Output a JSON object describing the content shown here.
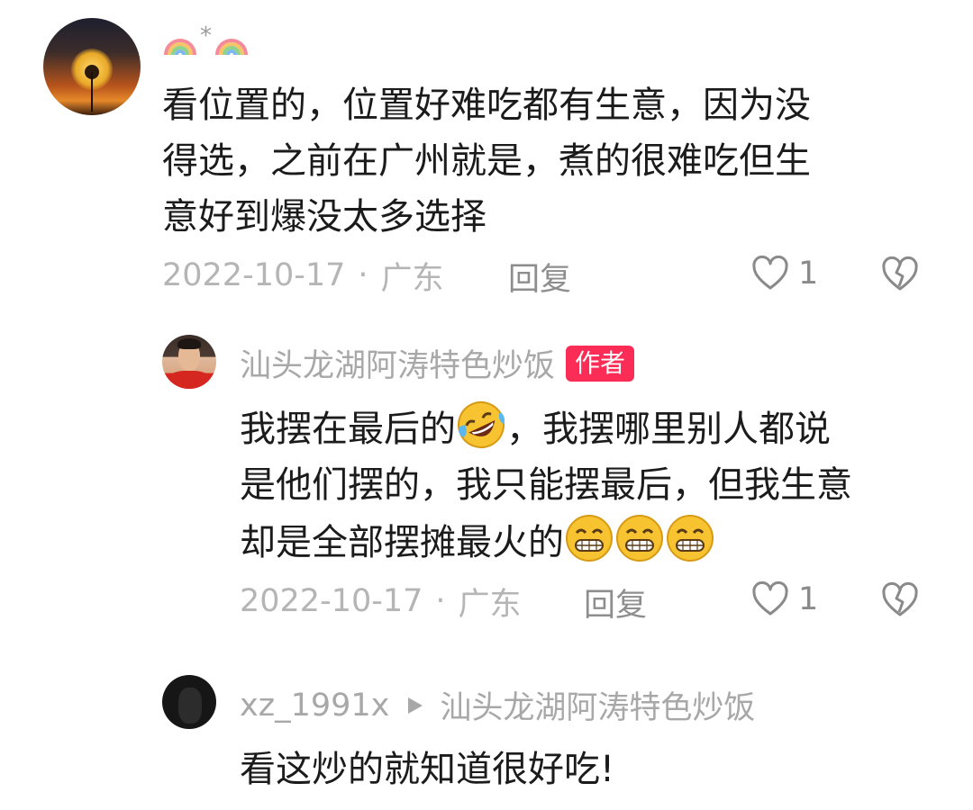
{
  "comments": [
    {
      "username_emoji": "🌈*🌈",
      "text_lines": [
        "看位置的，位置好难吃都有生意，因为没",
        "得选，之前在广州就是，煮的很难吃但生",
        "意好到爆没太多选择"
      ],
      "date": "2022-10-17",
      "location": "广东",
      "reply_label": "回复",
      "like_count": "1"
    },
    {
      "username": "汕头龙湖阿涛特色炒饭",
      "badge": "作者",
      "text_line1_before_emoji": "我摆在最后的",
      "text_line1_after_emoji": "，我摆哪里别人都说",
      "text_line2": "是他们摆的，我只能摆最后，但我生意",
      "text_line3": "却是全部摆摊最火的",
      "date": "2022-10-17",
      "location": "广东",
      "reply_label": "回复",
      "like_count": "1"
    },
    {
      "username": "xz_1991x",
      "reply_to": "汕头龙湖阿涛特色炒饭",
      "text": "看这炒的就知道很好吃!"
    }
  ],
  "icons": {
    "like": "heart-outline-icon",
    "dislike": "broken-heart-icon",
    "reply_arrow": "triangle-right-icon"
  },
  "colors": {
    "badge": "#fb2c55",
    "username": "#a8a8a8",
    "meta": "#b5b5b5"
  }
}
